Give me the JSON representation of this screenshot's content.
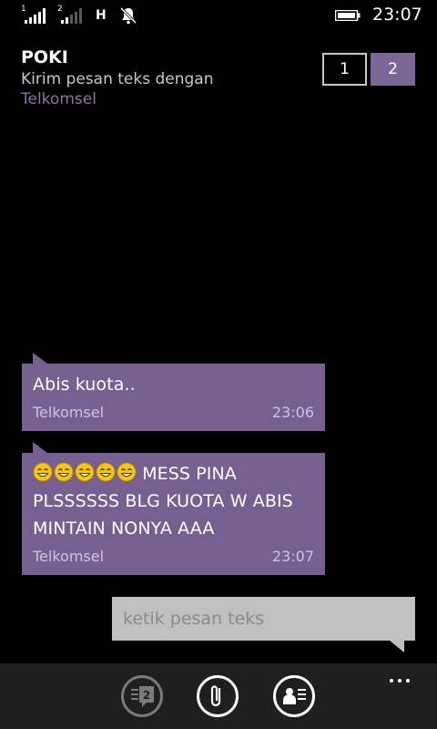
{
  "status_bar": {
    "sim1_label": "1",
    "sim2_label": "2",
    "network_type": "H",
    "time": "23:07",
    "icons": [
      "signal-icon",
      "signal-icon",
      "quiet-hours-icon",
      "battery-icon"
    ]
  },
  "header": {
    "contact_name": "POKI",
    "subtitle": "Kirim pesan teks dengan",
    "carrier": "Telkomsel"
  },
  "sim_switch": {
    "option1": "1",
    "option2": "2",
    "selected": "2"
  },
  "messages": [
    {
      "text": "Abis kuota..",
      "carrier": "Telkomsel",
      "time": "23:06"
    },
    {
      "emoji_count": 5,
      "text": " MESS PINA PLSSSSSS BLG KUOTA W ABIS MINTAIN NONYA AAA",
      "carrier": "Telkomsel",
      "time": "23:07"
    }
  ],
  "compose": {
    "placeholder": "ketik pesan teks"
  },
  "app_bar": {
    "sim_badge": "2",
    "icons": [
      "switch-sim-icon",
      "attach-icon",
      "contact-card-icon",
      "more-icon"
    ]
  },
  "colors": {
    "accent": "#75608f",
    "accent_text": "#8a73a6",
    "background": "#000000",
    "app_bar": "#1f1f1f"
  }
}
